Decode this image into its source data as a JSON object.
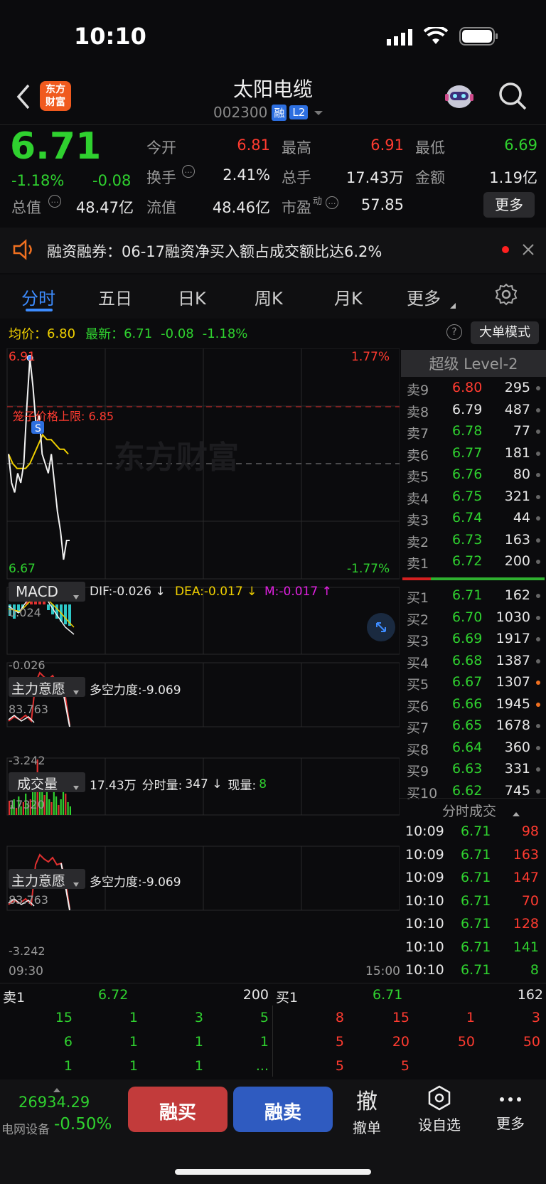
{
  "status_bar": {
    "time": "10:10"
  },
  "header": {
    "title": "太阳电缆",
    "code": "002300",
    "badge_margin": "融",
    "badge_l2": "L2",
    "logo_text": "东方\n财富"
  },
  "quote": {
    "price": "6.71",
    "change_pct": "-1.18%",
    "change": "-0.08",
    "open_label": "今开",
    "open": "6.81",
    "high_label": "最高",
    "high": "6.91",
    "low_label": "最低",
    "low": "6.69",
    "turnover_label": "换手",
    "turnover": "2.41%",
    "volume_label": "总手",
    "volume": "17.43万",
    "amount_label": "金额",
    "amount": "1.19亿",
    "mktcap_label": "总值",
    "mktcap": "48.47亿",
    "float_label": "流值",
    "float": "48.46亿",
    "pe_label": "市盈",
    "pe_sup": "动",
    "pe": "57.85",
    "more": "更多"
  },
  "notice": {
    "text": "融资融券：06-17融资净买入额占成交额比达6.2%"
  },
  "tabs": {
    "t1": "分时",
    "t2": "五日",
    "t3": "日K",
    "t4": "周K",
    "t5": "月K",
    "t6": "更多"
  },
  "chart_bar": {
    "avg_label": "均价：",
    "avg": "6.80",
    "last_label": "最新：",
    "last": "6.71",
    "chg": "-0.08",
    "pct": "-1.18%",
    "mode": "大单模式"
  },
  "chart_data": {
    "type": "line",
    "title": "",
    "yticks": {
      "top": "6.91",
      "bottom": "6.67",
      "top_pct": "1.77%",
      "bottom_pct": "-1.77%"
    },
    "limit_label": "笼子价格上限: 6.85",
    "watermark": "东方财富",
    "xticks": {
      "start": "09:30",
      "end": "15:00"
    },
    "marker": "S",
    "ylim": [
      6.67,
      6.91
    ],
    "price_series": [
      6.8,
      6.77,
      6.76,
      6.78,
      6.77,
      6.79,
      6.85,
      6.9,
      6.87,
      6.83,
      6.84,
      6.8,
      6.79,
      6.78,
      6.8,
      6.77,
      6.74,
      6.72,
      6.69,
      6.71,
      6.71
    ],
    "avg_series": [
      6.8,
      6.79,
      6.785,
      6.785,
      6.785,
      6.79,
      6.8,
      6.81,
      6.82,
      6.815,
      6.815,
      6.81,
      6.805,
      6.805,
      6.8
    ]
  },
  "macd": {
    "label": "MACD",
    "dif": "DIF:-0.026 ↓",
    "dea": "DEA:-0.017 ↓",
    "m": "M:-0.017 ↑",
    "top": "0.024",
    "bottom": "-0.026"
  },
  "ind1": {
    "label": "主力意愿",
    "desc": "多空力度:-9.069",
    "top": "83.763",
    "bottom": "-3.242"
  },
  "vol": {
    "label": "成交量",
    "total": "17.43万",
    "seg_label": "分时量:",
    "seg": "347 ↓",
    "now_label": "现量:",
    "now": "8",
    "top": "17320"
  },
  "ind2": {
    "label": "主力意愿",
    "desc": "多空力度:-9.069",
    "top": "83.763",
    "bottom": "-3.242"
  },
  "level2": {
    "title": "超级 Level-2",
    "asks": [
      {
        "label": "卖9",
        "price": "6.80",
        "qty": "295"
      },
      {
        "label": "卖8",
        "price": "6.79",
        "qty": "487"
      },
      {
        "label": "卖7",
        "price": "6.78",
        "qty": "77"
      },
      {
        "label": "卖6",
        "price": "6.77",
        "qty": "181"
      },
      {
        "label": "卖5",
        "price": "6.76",
        "qty": "80"
      },
      {
        "label": "卖4",
        "price": "6.75",
        "qty": "321"
      },
      {
        "label": "卖3",
        "price": "6.74",
        "qty": "44"
      },
      {
        "label": "卖2",
        "price": "6.73",
        "qty": "163"
      },
      {
        "label": "卖1",
        "price": "6.72",
        "qty": "200"
      }
    ],
    "bids": [
      {
        "label": "买1",
        "price": "6.71",
        "qty": "162"
      },
      {
        "label": "买2",
        "price": "6.70",
        "qty": "1030"
      },
      {
        "label": "买3",
        "price": "6.69",
        "qty": "1917"
      },
      {
        "label": "买4",
        "price": "6.68",
        "qty": "1387"
      },
      {
        "label": "买5",
        "price": "6.67",
        "qty": "1307"
      },
      {
        "label": "买6",
        "price": "6.66",
        "qty": "1945"
      },
      {
        "label": "买7",
        "price": "6.65",
        "qty": "1678"
      },
      {
        "label": "买8",
        "price": "6.64",
        "qty": "360"
      },
      {
        "label": "买9",
        "price": "6.63",
        "qty": "331"
      },
      {
        "label": "买10",
        "price": "6.62",
        "qty": "745"
      }
    ],
    "trades_title": "分时成交",
    "trades": [
      {
        "t": "10:09",
        "p": "6.71",
        "v": "98",
        "side": "r"
      },
      {
        "t": "10:09",
        "p": "6.71",
        "v": "163",
        "side": "r"
      },
      {
        "t": "10:09",
        "p": "6.71",
        "v": "147",
        "side": "r"
      },
      {
        "t": "10:10",
        "p": "6.71",
        "v": "70",
        "side": "r"
      },
      {
        "t": "10:10",
        "p": "6.71",
        "v": "128",
        "side": "r"
      },
      {
        "t": "10:10",
        "p": "6.71",
        "v": "141",
        "side": "g"
      },
      {
        "t": "10:10",
        "p": "6.71",
        "v": "8",
        "side": "g"
      }
    ]
  },
  "queue": {
    "ask_label": "卖1",
    "ask_price": "6.72",
    "ask_qty": "200",
    "bid_label": "买1",
    "bid_price": "6.71",
    "bid_qty": "162",
    "ask_rows": [
      [
        "15",
        "1",
        "3",
        "5"
      ],
      [
        "6",
        "1",
        "1",
        "1"
      ],
      [
        "1",
        "1",
        "1",
        "..."
      ]
    ],
    "bid_rows": [
      [
        "8",
        "15",
        "1",
        "3"
      ],
      [
        "5",
        "20",
        "50",
        "50"
      ],
      [
        "5",
        "5",
        "",
        ""
      ]
    ]
  },
  "bottom": {
    "index": "26934.29",
    "sector": "电网设备",
    "sector_pct": "-0.50%",
    "buy": "融买",
    "sell": "融卖",
    "cancel_icon": "撤",
    "cancel": "撤单",
    "watch": "设自选",
    "more": "更多"
  }
}
